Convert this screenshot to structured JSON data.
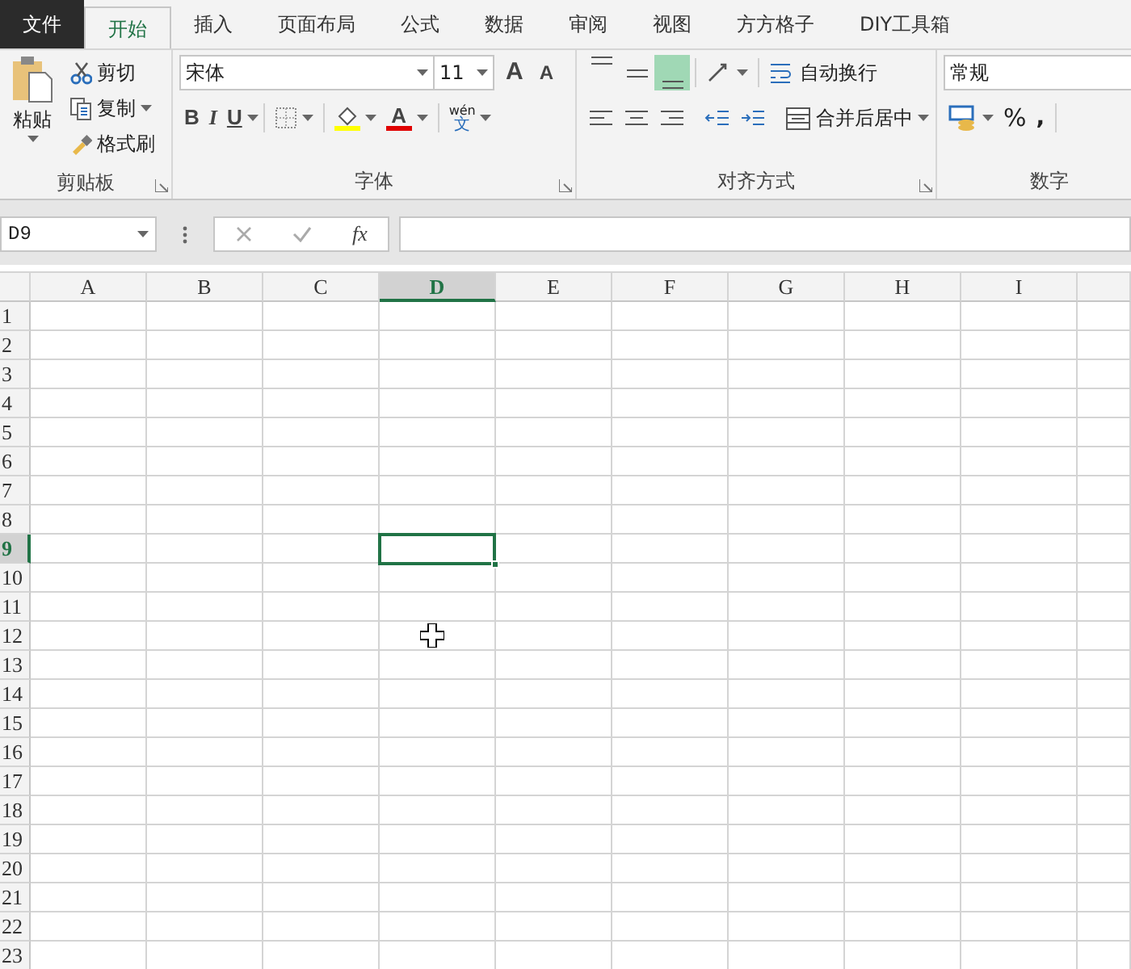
{
  "tabs": [
    {
      "label": "文件",
      "kind": "file",
      "selected": false
    },
    {
      "label": "开始",
      "kind": "tab",
      "selected": true
    },
    {
      "label": "插入",
      "kind": "tab",
      "selected": false
    },
    {
      "label": "页面布局",
      "kind": "tab",
      "selected": false
    },
    {
      "label": "公式",
      "kind": "tab",
      "selected": false
    },
    {
      "label": "数据",
      "kind": "tab",
      "selected": false
    },
    {
      "label": "审阅",
      "kind": "tab",
      "selected": false
    },
    {
      "label": "视图",
      "kind": "tab",
      "selected": false
    },
    {
      "label": "方方格子",
      "kind": "tab",
      "selected": false
    },
    {
      "label": "DIY工具箱",
      "kind": "tab",
      "selected": false
    }
  ],
  "clipboard": {
    "paste": "粘贴",
    "cut": "剪切",
    "copy": "复制",
    "format_painter": "格式刷",
    "group_label": "剪贴板"
  },
  "font": {
    "font_name": "宋体",
    "font_size": "11",
    "grow": "A",
    "shrink": "A",
    "bold": "B",
    "italic": "I",
    "underline": "U",
    "font_color": "A",
    "phonetic_top": "wén",
    "phonetic_bottom": "文",
    "group_label": "字体"
  },
  "alignment": {
    "vertical": [
      {
        "kind": "top",
        "selected": false
      },
      {
        "kind": "middle",
        "selected": false
      },
      {
        "kind": "bottom",
        "selected": true
      }
    ],
    "horizontal": [
      {
        "kind": "left",
        "selected": false
      },
      {
        "kind": "center",
        "selected": false
      },
      {
        "kind": "right",
        "selected": false
      }
    ],
    "wrap_text": "自动换行",
    "merge_center": "合并后居中",
    "group_label": "对齐方式"
  },
  "number": {
    "format": "常规",
    "percent": "%",
    "comma": ",",
    "group_label": "数字"
  },
  "formula_bar": {
    "name_box": "D9",
    "fx": "fx"
  },
  "grid": {
    "columns": [
      {
        "label": "A",
        "selected": false
      },
      {
        "label": "B",
        "selected": false
      },
      {
        "label": "C",
        "selected": false
      },
      {
        "label": "D",
        "selected": true
      },
      {
        "label": "E",
        "selected": false
      },
      {
        "label": "F",
        "selected": false
      },
      {
        "label": "G",
        "selected": false
      },
      {
        "label": "H",
        "selected": false
      },
      {
        "label": "I",
        "selected": false
      }
    ],
    "rows": [
      {
        "label": "1",
        "selected": false
      },
      {
        "label": "2",
        "selected": false
      },
      {
        "label": "3",
        "selected": false
      },
      {
        "label": "4",
        "selected": false
      },
      {
        "label": "5",
        "selected": false
      },
      {
        "label": "6",
        "selected": false
      },
      {
        "label": "7",
        "selected": false
      },
      {
        "label": "8",
        "selected": false
      },
      {
        "label": "9",
        "selected": true
      },
      {
        "label": "10",
        "selected": false
      },
      {
        "label": "11",
        "selected": false
      },
      {
        "label": "12",
        "selected": false
      },
      {
        "label": "13",
        "selected": false
      },
      {
        "label": "14",
        "selected": false
      },
      {
        "label": "15",
        "selected": false
      },
      {
        "label": "16",
        "selected": false
      },
      {
        "label": "17",
        "selected": false
      },
      {
        "label": "18",
        "selected": false
      },
      {
        "label": "19",
        "selected": false
      },
      {
        "label": "20",
        "selected": false
      },
      {
        "label": "21",
        "selected": false
      },
      {
        "label": "22",
        "selected": false
      },
      {
        "label": "23",
        "selected": false
      }
    ]
  }
}
